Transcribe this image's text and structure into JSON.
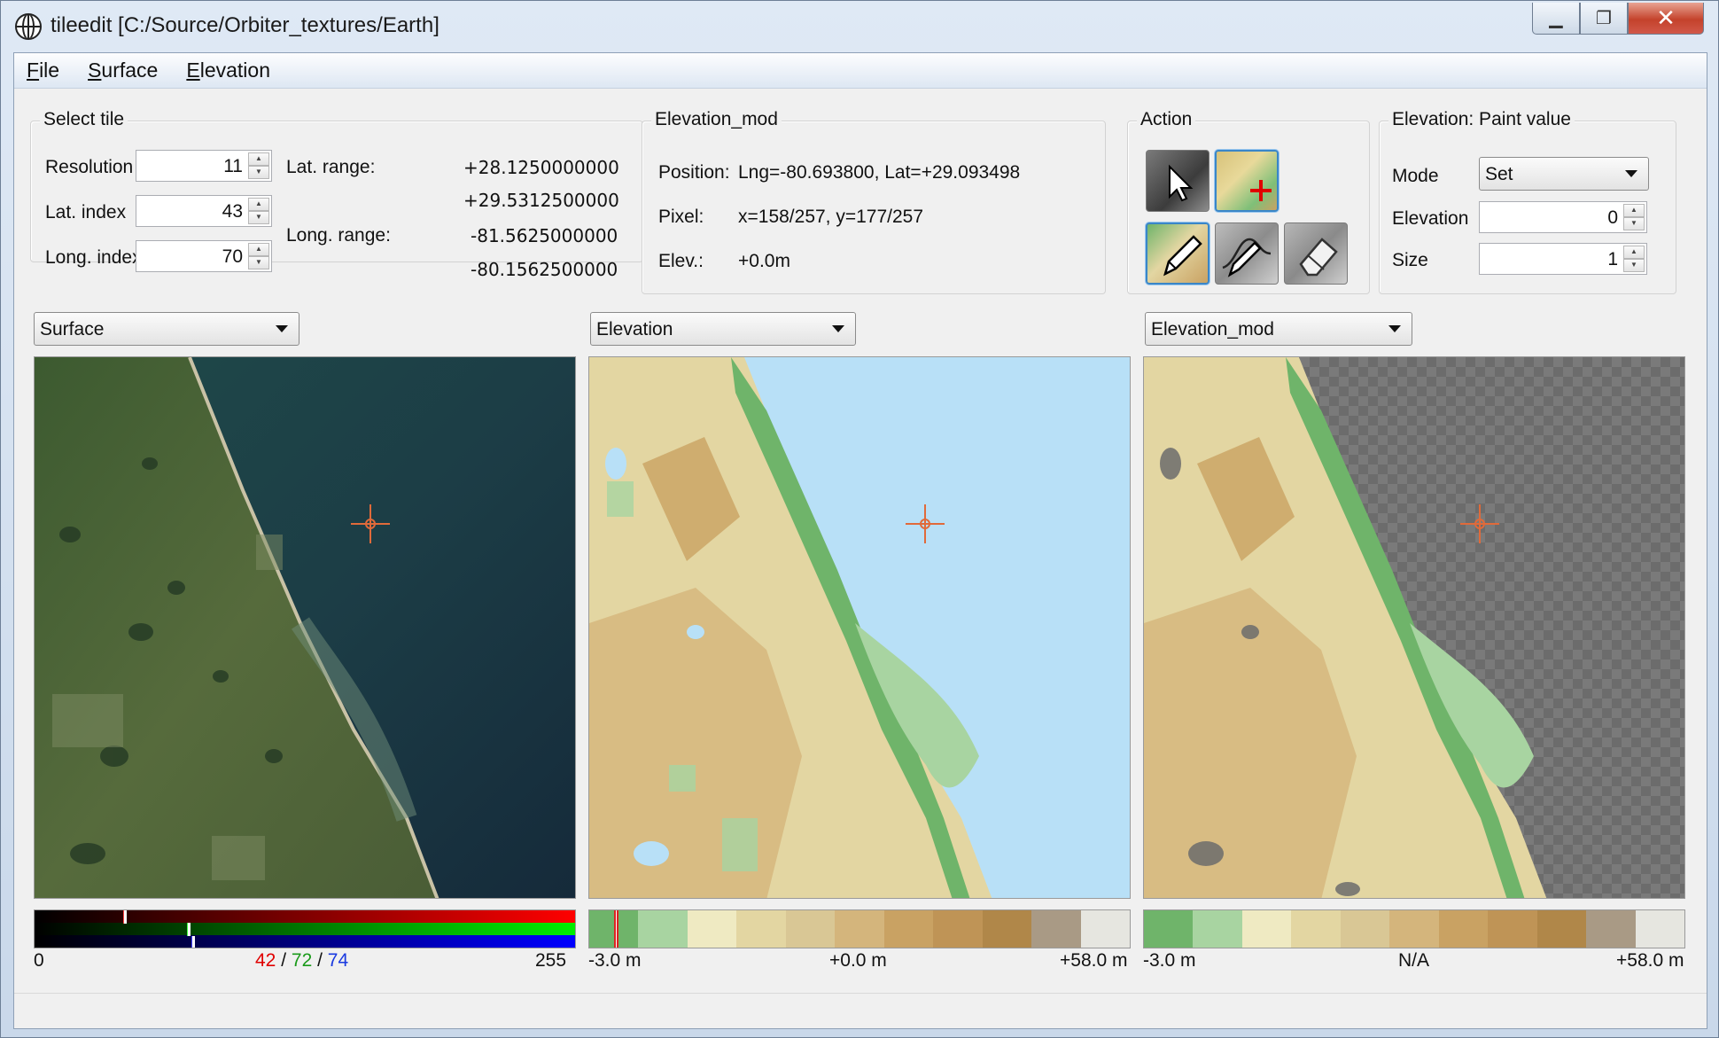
{
  "window": {
    "title": "tileedit [C:/Source/Orbiter_textures/Earth]"
  },
  "menu": [
    "File",
    "Surface",
    "Elevation"
  ],
  "select_tile": {
    "title": "Select tile",
    "resolution_label": "Resolution",
    "resolution_value": "11",
    "lat_index_label": "Lat. index",
    "lat_index_value": "43",
    "long_index_label": "Long. index",
    "long_index_value": "70",
    "lat_range_label": "Lat. range:",
    "lat_range_min": "+28.1250000000",
    "lat_range_max": "+29.5312500000",
    "long_range_label": "Long. range:",
    "long_range_min": "-81.5625000000",
    "long_range_max": "-80.1562500000"
  },
  "elevation_mod": {
    "title": "Elevation_mod",
    "position_label": "Position:",
    "position_value": "Lng=-80.693800, Lat=+29.093498",
    "pixel_label": "Pixel:",
    "pixel_value": "x=158/257, y=177/257",
    "elev_label": "Elev.:",
    "elev_value": "+0.0m"
  },
  "action": {
    "title": "Action",
    "tools": [
      "pointer-tool",
      "add-tile-tool",
      "pencil-tool",
      "curve-tool",
      "eraser-tool"
    ],
    "active_tools": [
      "add-tile-tool",
      "pencil-tool"
    ]
  },
  "paint": {
    "title": "Elevation: Paint value",
    "mode_label": "Mode",
    "mode_value": "Set",
    "elevation_label": "Elevation",
    "elevation_value": "0",
    "size_label": "Size",
    "size_value": "1"
  },
  "panes": [
    {
      "selector": "Surface",
      "scale_left": "0",
      "scale_right": "255",
      "rgb": {
        "r": "42",
        "g": "72",
        "b": "74",
        "sep": "/"
      }
    },
    {
      "selector": "Elevation",
      "scale_left": "-3.0 m",
      "scale_mid": "+0.0 m",
      "scale_right": "+58.0 m"
    },
    {
      "selector": "Elevation_mod",
      "scale_left": "-3.0 m",
      "scale_mid": "N/A",
      "scale_right": "+58.0 m"
    }
  ],
  "colors": {
    "elevation_ramp": [
      "#6fb46a",
      "#a8d4a1",
      "#efeac2",
      "#e3d6a2",
      "#d9c795",
      "#d4b57c",
      "#c9a263",
      "#bf9456",
      "#b08749",
      "#a99a85",
      "#e6e6e0"
    ],
    "water": "#b8e0f7",
    "crosshair": "#e06a3a"
  }
}
